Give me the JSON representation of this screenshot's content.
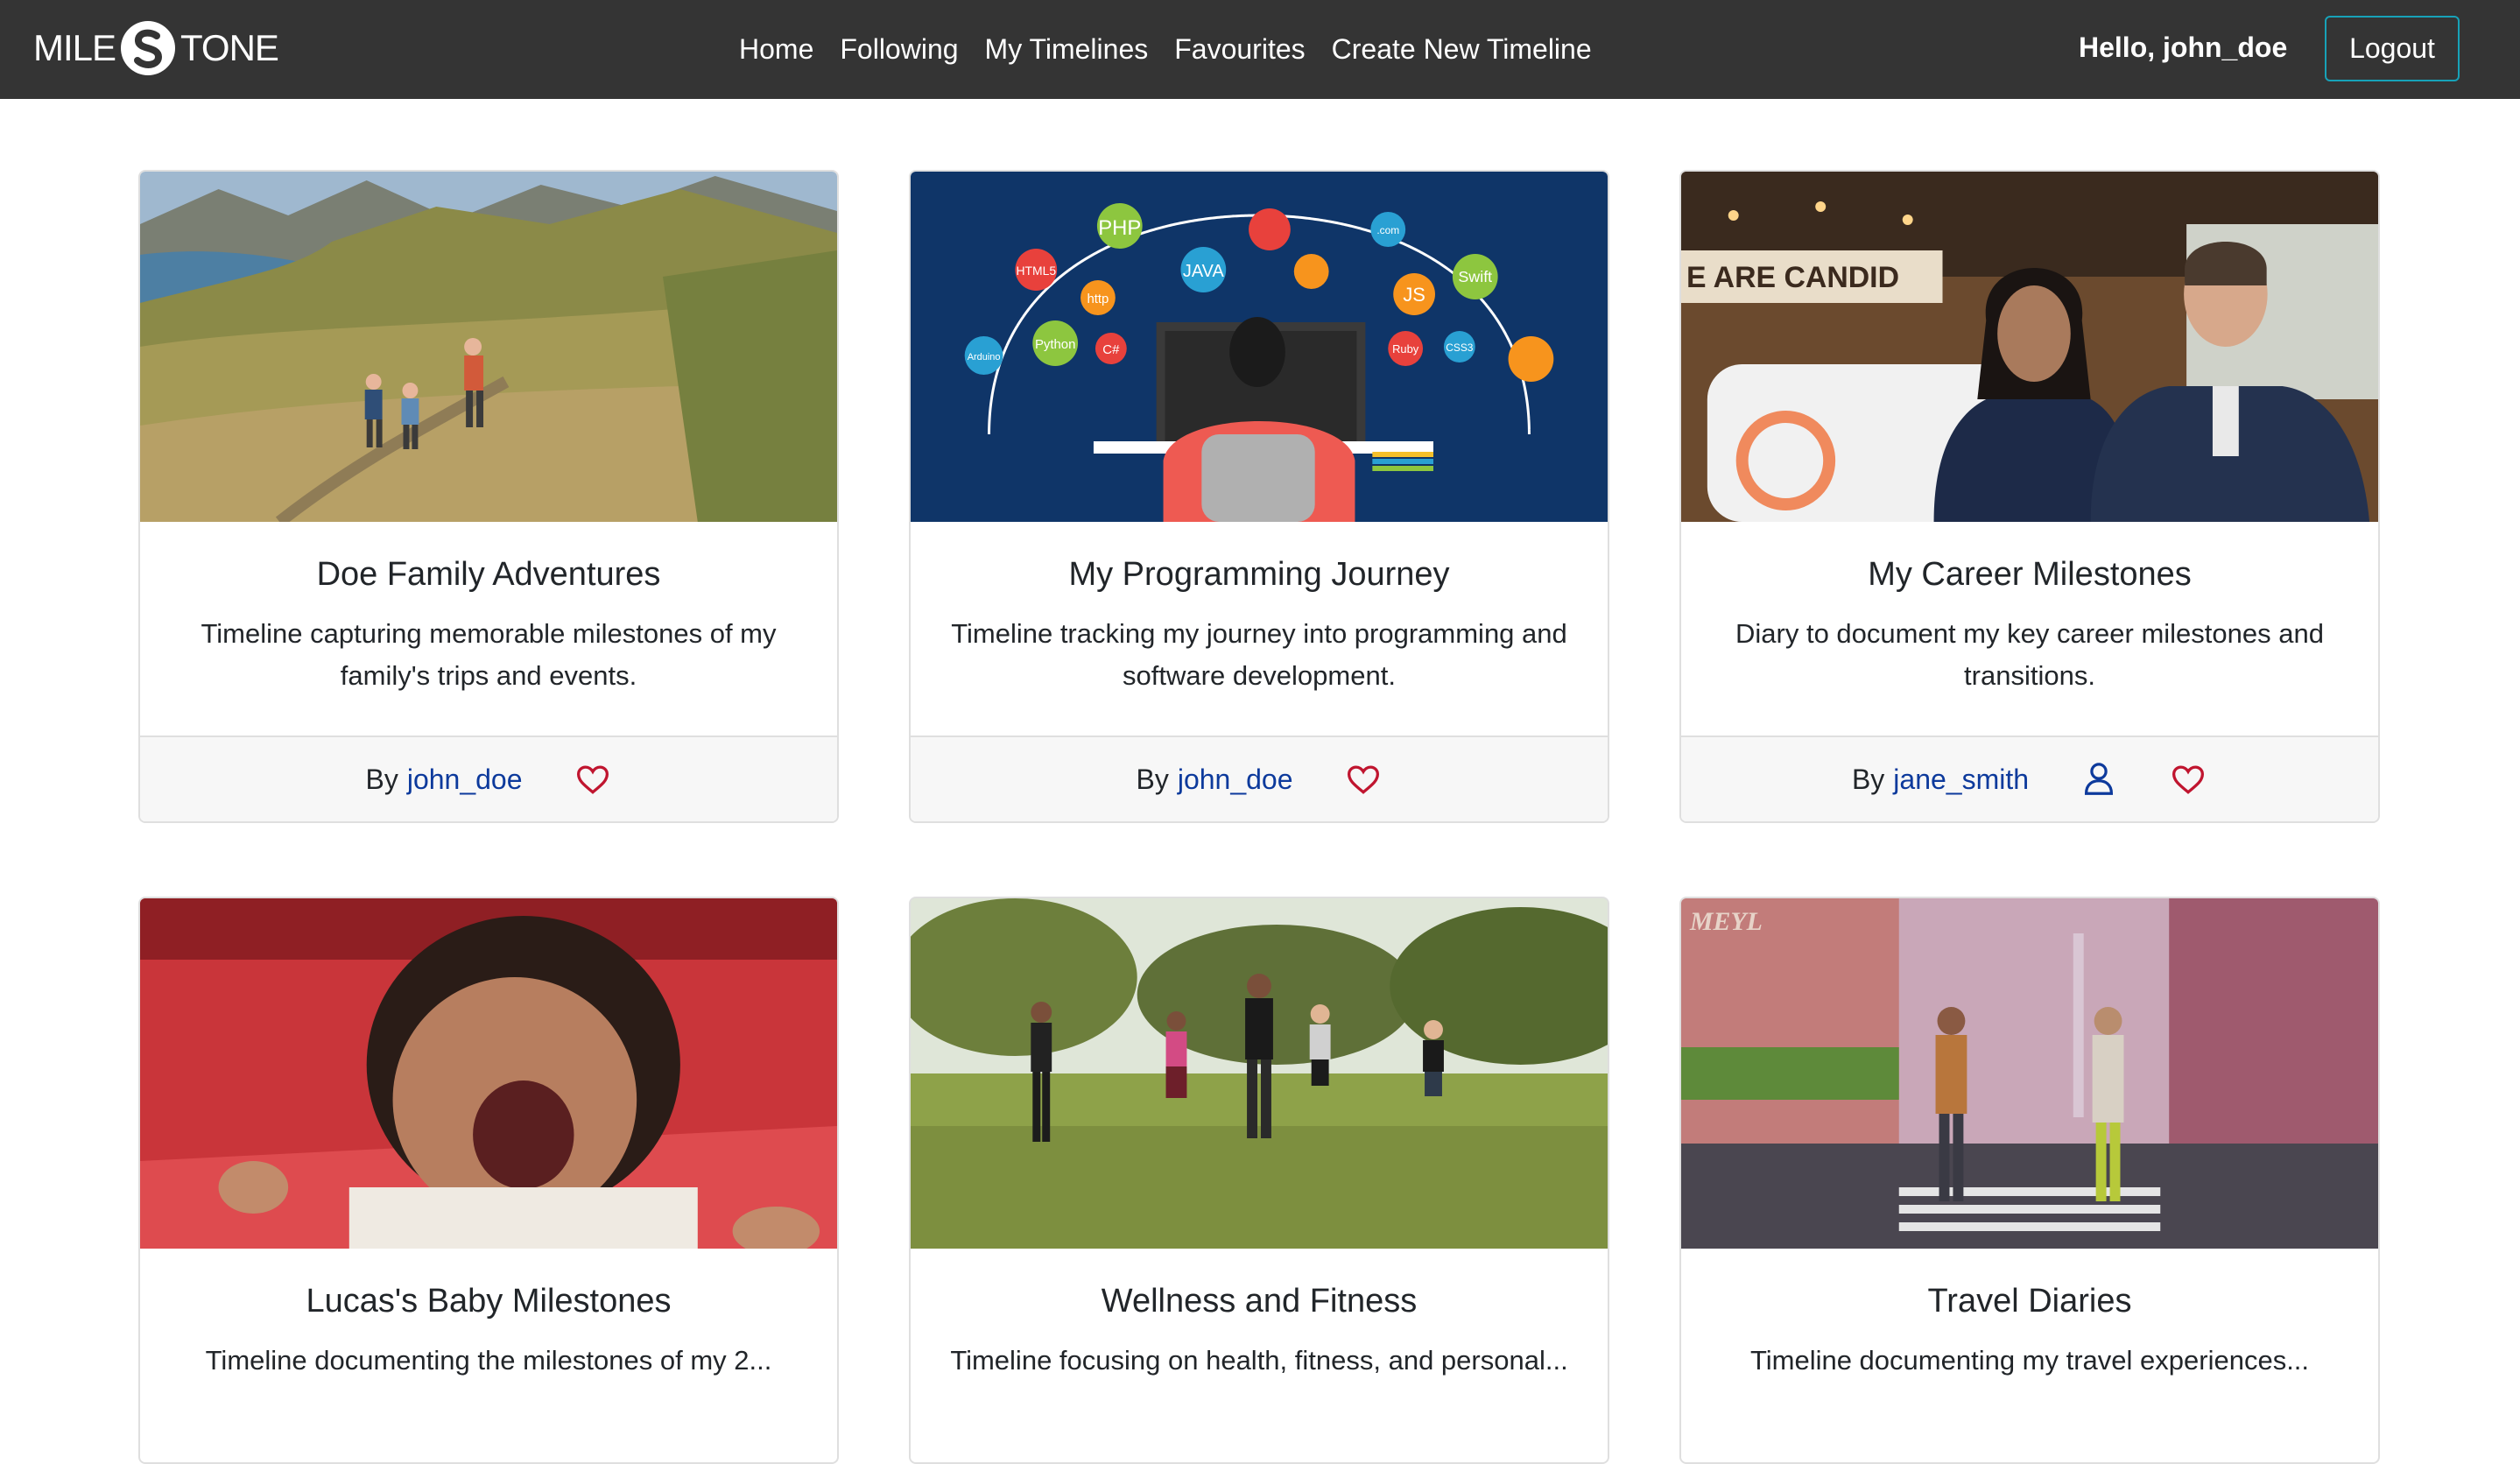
{
  "navbar": {
    "logo_left": "MILE",
    "logo_right": "TONE",
    "links": [
      "Home",
      "Following",
      "My Timelines",
      "Favourites",
      "Create New Timeline"
    ],
    "greeting": "Hello, john_doe",
    "logout_label": "Logout"
  },
  "cards": [
    {
      "title": "Doe Family Adventures",
      "description": "Timeline capturing memorable milestones of my family's trips and events.",
      "by_label": "By",
      "author": "john_doe",
      "image": "mountain-hiking-family-photo",
      "follow_icon": false
    },
    {
      "title": "My Programming Journey",
      "description": "Timeline tracking my journey into programming and software development.",
      "by_label": "By",
      "author": "john_doe",
      "image": "programming-languages-illustration",
      "follow_icon": false,
      "image_labels": [
        "PHP",
        "HTML5",
        "JAVA",
        "http",
        "JS",
        "Swift",
        "Python",
        "C#",
        "Ruby",
        "CSS3",
        "Arduino",
        ".com"
      ]
    },
    {
      "title": "My Career Milestones",
      "description": "Diary to document my key career milestones and transitions.",
      "by_label": "By",
      "author": "jane_smith",
      "image": "business-people-office-photo",
      "follow_icon": true,
      "image_labels": [
        "E ARE CANDID"
      ]
    },
    {
      "title": "Lucas's Baby Milestones",
      "description": "Timeline documenting the milestones of my 2...",
      "image": "laughing-baby-photo"
    },
    {
      "title": "Wellness and Fitness",
      "description": "Timeline focusing on health, fitness, and personal...",
      "image": "outdoor-exercise-group-photo"
    },
    {
      "title": "Travel Diaries",
      "description": "Timeline documenting my travel experiences...",
      "image": "city-street-night-photo",
      "image_labels": [
        "MEYL"
      ]
    }
  ],
  "colors": {
    "navbar_bg": "#343434",
    "logout_border": "#17a2b8",
    "author_link": "#0d3a9c",
    "heart_icon": "#c0152f",
    "follow_icon": "#0d3a9c"
  }
}
